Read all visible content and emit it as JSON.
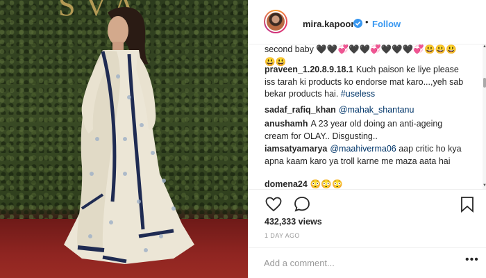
{
  "post": {
    "account": {
      "username": "mira.kapoor",
      "separator": "•",
      "follow_label": "Follow"
    },
    "comments": [
      {
        "user": "",
        "text": "second baby 🖤🖤💞🖤🖤💞🖤🖤🖤💞😃😃😃😃😃"
      },
      {
        "user": "praveen_1.20.8.9.18.1",
        "text": "Kuch paison ke liye please iss tarah ki products ko endorse mat karo...,yeh sab bekar products hai.",
        "hashtag": "#useless"
      },
      {
        "user": "sadaf_rafiq_khan",
        "mention": "@mahak_shantanu"
      },
      {
        "user": "anushamh",
        "text": "A 23 year old doing an anti-ageing cream for OLAY.. Disgusting.."
      },
      {
        "user": "iamsatyamarya",
        "mention": "@maahiverma06",
        "text": "aap critic ho kya apna kaam karo ya troll karne me maza aata hai"
      },
      {
        "user": "domena24",
        "text": "😳😳😳"
      }
    ],
    "views": "432,333 views",
    "timestamp": "1 DAY AGO",
    "add_comment_placeholder": "Add a comment...",
    "more_options": "•••"
  },
  "photo": {
    "sign_text": "SVA"
  },
  "colors": {
    "link": "#3897f0",
    "mention": "#003569",
    "carpet": "#8f2521",
    "foliage": "#3a4b25"
  }
}
